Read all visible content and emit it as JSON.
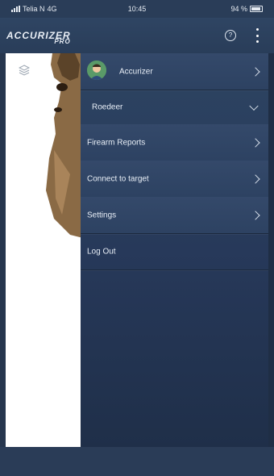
{
  "status_bar": {
    "carrier": "Telia N",
    "network": "4G",
    "time": "10:45",
    "battery": "94 %"
  },
  "app_bar": {
    "logo_main": "ACCURIZER",
    "logo_sub": "PRO",
    "help_icon": "?"
  },
  "drawer": {
    "user": {
      "name": "Accurizer"
    },
    "profile": "Roedeer",
    "items": [
      {
        "label": "Firearm Reports"
      },
      {
        "label": "Connect to target"
      },
      {
        "label": "Settings"
      },
      {
        "label": "Log Out"
      }
    ]
  },
  "icons": {
    "layers": "layers-icon",
    "help": "help-icon",
    "more": "more-vertical-icon",
    "chevron_right": "chevron-right-icon",
    "chevron_down": "chevron-down-icon"
  },
  "colors": {
    "drawer_bg": "#2d4462",
    "app_bar_bg": "#2f4563",
    "text": "#e8eef6"
  }
}
